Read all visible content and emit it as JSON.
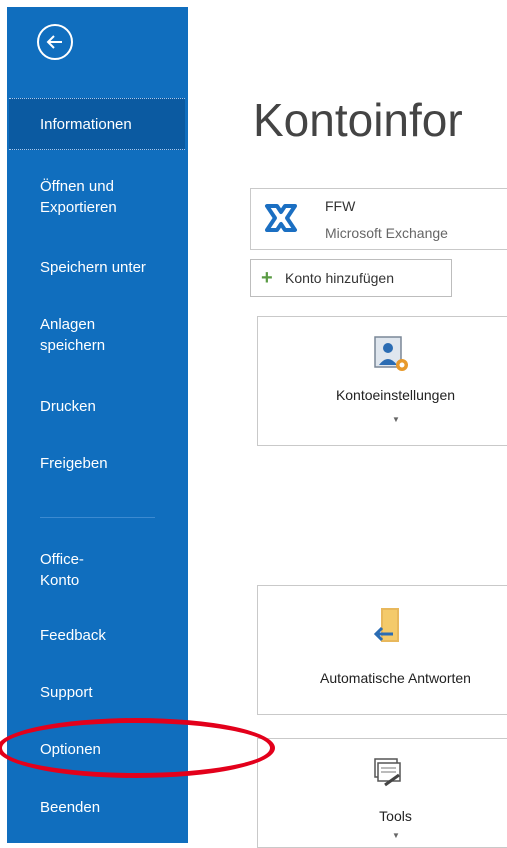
{
  "sidebar": {
    "items": [
      {
        "label": "Informationen"
      },
      {
        "label": "Öffnen und"
      },
      {
        "label": "Exportieren"
      },
      {
        "label": "Speichern unter"
      },
      {
        "label": "Anlagen"
      },
      {
        "label": "speichern"
      },
      {
        "label": "Drucken"
      },
      {
        "label": "Freigeben"
      },
      {
        "label": "Office-"
      },
      {
        "label": "Konto"
      },
      {
        "label": "Feedback"
      },
      {
        "label": "Support"
      },
      {
        "label": "Optionen"
      },
      {
        "label": "Beenden"
      }
    ]
  },
  "main": {
    "title": "Kontoinfor",
    "account": {
      "name": "FFW",
      "type": "Microsoft Exchange"
    },
    "add_account_label": "Konto hinzufügen",
    "tiles": [
      {
        "label": "Kontoeinstellungen"
      },
      {
        "label": "Automatische Antworten"
      },
      {
        "label": "Tools"
      }
    ]
  },
  "colors": {
    "sidebar": "#106ebe",
    "active_item": "#0b5aa1",
    "highlight_ellipse": "#e3001b"
  }
}
